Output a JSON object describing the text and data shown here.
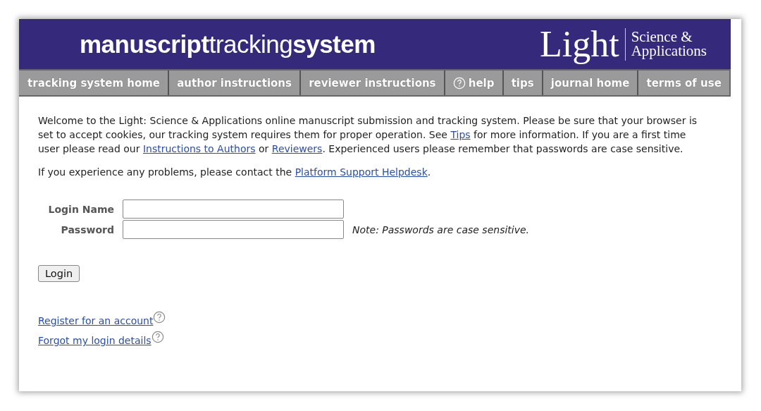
{
  "header": {
    "title_parts": [
      {
        "text": "manuscript",
        "kind": "bold"
      },
      {
        "text": "tracking",
        "kind": "light"
      },
      {
        "text": "system",
        "kind": "bold"
      }
    ],
    "journal_logo": {
      "name": "Light",
      "subtitle_lines": [
        "Science &",
        "Applications"
      ]
    }
  },
  "nav": [
    {
      "label": "tracking system home",
      "kind": "plain"
    },
    {
      "label": "author instructions",
      "kind": "plain"
    },
    {
      "label": "reviewer instructions",
      "kind": "plain"
    },
    {
      "label": "help",
      "kind": "help"
    },
    {
      "label": "tips",
      "kind": "plain"
    },
    {
      "label": "journal home",
      "kind": "plain"
    },
    {
      "label": "terms of use",
      "kind": "plain"
    }
  ],
  "paragraphs": [
    [
      {
        "kind": "text",
        "text": "Welcome to the Light: Science & Applications online manuscript submission and tracking system. Please be sure that your browser is set to accept cookies, our tracking system requires them for proper operation. See "
      },
      {
        "kind": "link",
        "text": "Tips"
      },
      {
        "kind": "text",
        "text": " for more information. If you are a first time user please read our "
      },
      {
        "kind": "link",
        "text": "Instructions to Authors"
      },
      {
        "kind": "text",
        "text": " or "
      },
      {
        "kind": "link",
        "text": "Reviewers"
      },
      {
        "kind": "text",
        "text": ". Experienced users please remember that passwords are case sensitive."
      }
    ],
    [
      {
        "kind": "text",
        "text": "If you experience any problems, please contact the "
      },
      {
        "kind": "link",
        "text": "Platform Support Helpdesk"
      },
      {
        "kind": "text",
        "text": "."
      }
    ]
  ],
  "form": {
    "fields": [
      {
        "label": "Login Name"
      },
      {
        "label": "Password",
        "note": "Note: Passwords are case sensitive."
      }
    ],
    "button": "Login"
  },
  "links": [
    {
      "text": "Register for an account"
    },
    {
      "text": "Forgot my login details"
    }
  ]
}
